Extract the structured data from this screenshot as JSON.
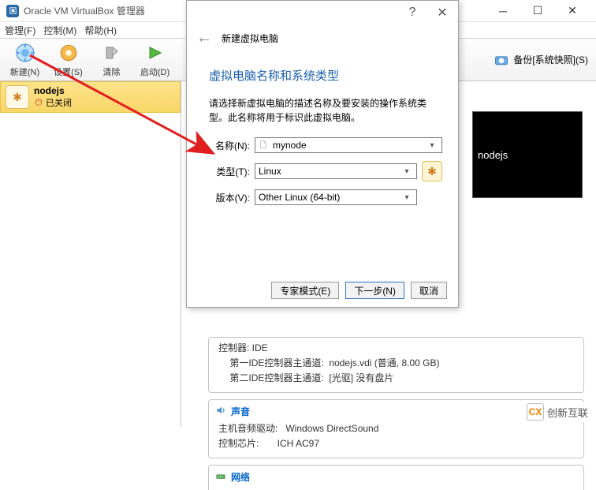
{
  "window": {
    "title": "Oracle VM VirtualBox 管理器"
  },
  "menu": {
    "manage": "管理(F)",
    "control": "控制(M)",
    "help": "帮助(H)"
  },
  "toolbar": {
    "new": "新建(N)",
    "settings": "设置(S)",
    "discard": "清除",
    "start": "启动(D)",
    "snapshot": "备份[系统快照](S)"
  },
  "sidebar": {
    "vm": {
      "name": "nodejs",
      "state": "已关闭"
    }
  },
  "preview": {
    "label": "nodejs"
  },
  "groups": {
    "storage": {
      "title": "控制器: IDE",
      "line1": "第一IDE控制器主通道:  nodejs.vdi (普通, 8.00 GB)",
      "line2": "第二IDE控制器主通道:  [光驱] 没有盘片"
    },
    "audio": {
      "title": "声音",
      "line1": "主机音频驱动:   Windows DirectSound",
      "line2": "控制芯片:       ICH AC97"
    },
    "network": {
      "title": "网络"
    }
  },
  "dialog": {
    "wizard_title": "新建虚拟电脑",
    "section_title": "虚拟电脑名称和系统类型",
    "desc": "请选择新虚拟电脑的描述名称及要安装的操作系统类型。此名称将用于标识此虚拟电脑。",
    "name_label": "名称(N):",
    "name_value": "mynode",
    "type_label": "类型(T):",
    "type_value": "Linux",
    "version_label": "版本(V):",
    "version_value": "Other Linux (64-bit)",
    "expert_btn": "专家模式(E)",
    "next_btn": "下一步(N)",
    "cancel_btn": "取消"
  },
  "watermark": {
    "text": "创新互联"
  }
}
